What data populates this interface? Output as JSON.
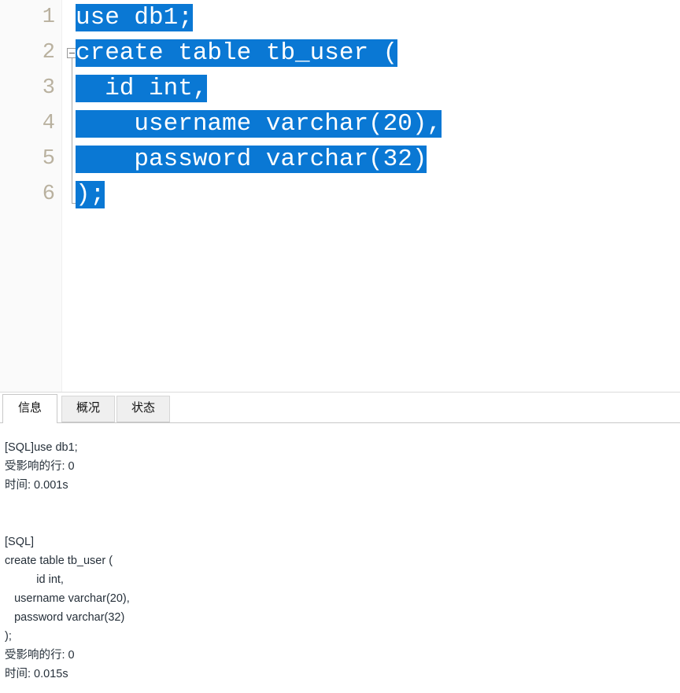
{
  "colors": {
    "selection_blue": "#0a78d4",
    "selection_text": "#ffffff",
    "gutter_bg": "#fafafa",
    "line_number": "#b9b19f",
    "code_text": "#202020",
    "output_text": "#26303a",
    "tab_active_bg": "#ffffff",
    "tab_inactive_bg": "#efefef"
  },
  "editor": {
    "gutter": {
      "line_numbers": [
        "1",
        "2",
        "3",
        "4",
        "5",
        "6"
      ]
    },
    "fold": {
      "marker_icon": "fold-minus-icon",
      "marker_line": "2",
      "state": "expanded"
    },
    "lines": [
      {
        "number": "1",
        "text": "use db1;",
        "selected": true
      },
      {
        "number": "2",
        "text": "create table tb_user (",
        "selected": true
      },
      {
        "number": "3",
        "text": "  id int,",
        "selected": true
      },
      {
        "number": "4",
        "text": "    username varchar(20),",
        "selected": true
      },
      {
        "number": "5",
        "text": "    password varchar(32)",
        "selected": true
      },
      {
        "number": "6",
        "text": ");",
        "selected": true
      }
    ]
  },
  "tabs": [
    {
      "label": "信息",
      "name": "tab-info",
      "active": true
    },
    {
      "label": "概况",
      "name": "tab-profile",
      "active": false
    },
    {
      "label": "状态",
      "name": "tab-status",
      "active": false
    }
  ],
  "output": {
    "lines": [
      "[SQL]use db1;",
      "受影响的行: 0",
      "时间: 0.001s",
      "",
      "",
      "[SQL]",
      "create table tb_user (",
      "          id int,",
      "   username varchar(20),",
      "   password varchar(32)",
      ");",
      "受影响的行: 0",
      "时间: 0.015s"
    ],
    "results": [
      {
        "statement": "use db1;",
        "affected_rows": "0",
        "time": "0.001s"
      },
      {
        "statement": "create table tb_user (\n          id int,\n   username varchar(20),\n   password varchar(32)\n);",
        "affected_rows": "0",
        "time": "0.015s"
      }
    ]
  }
}
